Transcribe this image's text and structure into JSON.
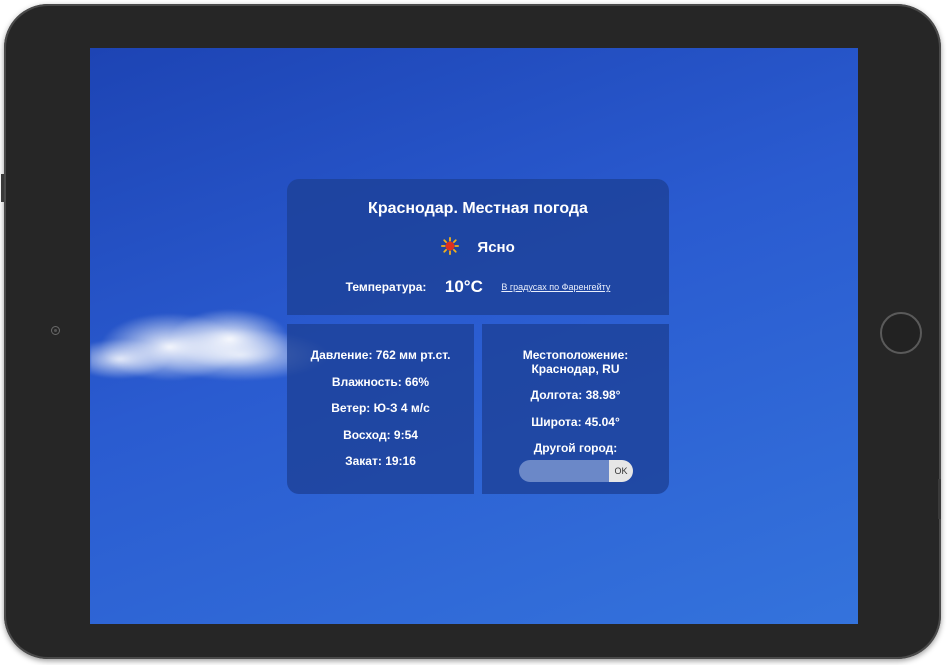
{
  "weather": {
    "title": "Краснодар. Местная погода",
    "condition": "Ясно",
    "condition_icon": "sun-icon",
    "temperature_label": "Температура:",
    "temperature_value": "10°C",
    "fahrenheit_link": "В градусах по Фаренгейту"
  },
  "details": {
    "pressure": "Давление: 762 мм рт.ст.",
    "humidity": "Влажность: 66%",
    "wind": "Ветер: Ю-З 4 м/с",
    "sunrise": "Восход: 9:54",
    "sunset": "Закат: 19:16"
  },
  "location": {
    "label": "Местоположение:",
    "place": "Краснодар, RU",
    "longitude": "Долгота: 38.98°",
    "latitude": "Широта: 45.04°",
    "other_city_label": "Другой город:",
    "city_input_value": "",
    "ok_button": "OK"
  },
  "colors": {
    "sky": "#2a5bd0",
    "panel": "#1c4096",
    "tablet_frame": "#262626",
    "sun": "#e0301e"
  }
}
